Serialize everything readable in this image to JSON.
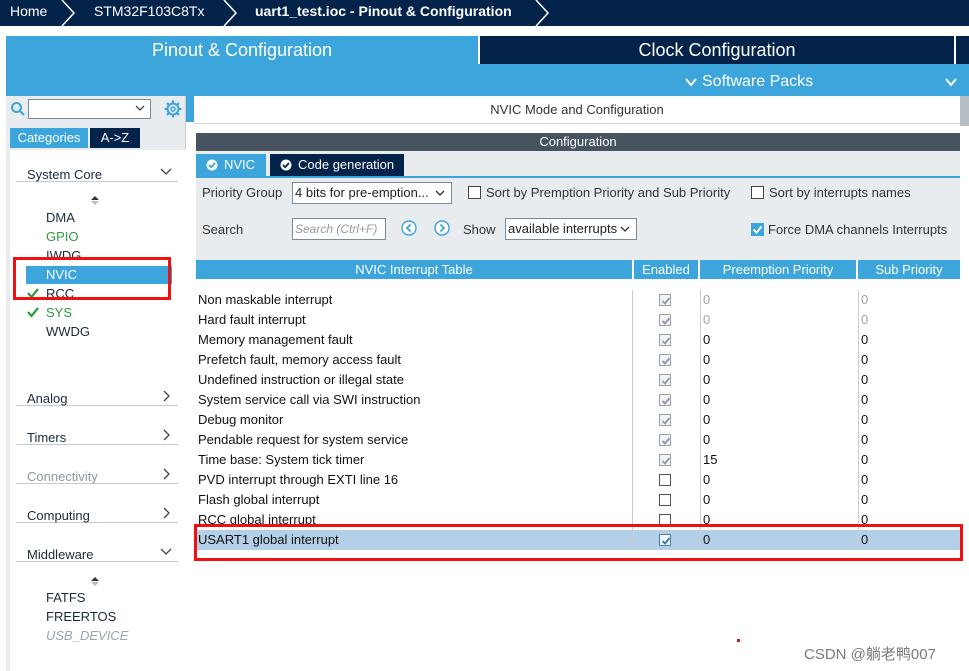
{
  "breadcrumb": [
    "Home",
    "STM32F103C8Tx",
    "uart1_test.ioc - Pinout & Configuration"
  ],
  "main_tabs": {
    "pinout": "Pinout & Configuration",
    "clock": "Clock Configuration",
    "software_packs": "Software Packs"
  },
  "left_panel": {
    "search_value": "",
    "tabs": [
      "Categories",
      "A->Z"
    ],
    "categories": [
      {
        "label": "System Core",
        "state": "expanded"
      },
      {
        "label": "Analog",
        "state": "collapsed"
      },
      {
        "label": "Timers",
        "state": "collapsed"
      },
      {
        "label": "Connectivity",
        "state": "collapsed"
      },
      {
        "label": "Computing",
        "state": "collapsed"
      },
      {
        "label": "Middleware",
        "state": "expanded"
      }
    ],
    "system_core_items": [
      {
        "label": "DMA",
        "style": "normal"
      },
      {
        "label": "GPIO",
        "style": "green"
      },
      {
        "label": "IWDG",
        "style": "normal"
      },
      {
        "label": "NVIC",
        "style": "selected"
      },
      {
        "label": "RCC",
        "style": "checked"
      },
      {
        "label": "SYS",
        "style": "checked"
      },
      {
        "label": "WWDG",
        "style": "normal"
      }
    ],
    "middleware_items": [
      {
        "label": "FATFS",
        "style": "normal"
      },
      {
        "label": "FREERTOS",
        "style": "normal"
      },
      {
        "label": "USB_DEVICE",
        "style": "disabled"
      }
    ]
  },
  "right_panel": {
    "title": "NVIC Mode and Configuration",
    "config_header": "Configuration",
    "subtabs": [
      "NVIC",
      "Code generation"
    ],
    "priority_group_label": "Priority Group",
    "priority_group_value": "4 bits for pre-emption...",
    "sort_preemption_label": "Sort by Premption Priority and Sub Priority",
    "sort_preemption_checked": false,
    "sort_names_label": "Sort by interrupts names",
    "sort_names_checked": false,
    "search_label": "Search",
    "search_placeholder": "Search (Ctrl+F)",
    "show_label": "Show",
    "show_value": "available interrupts",
    "force_dma_label": "Force DMA channels Interrupts",
    "force_dma_checked": true,
    "table": {
      "headers": [
        "NVIC Interrupt Table",
        "Enabled",
        "Preemption Priority",
        "Sub Priority"
      ],
      "rows": [
        {
          "name": "Non maskable interrupt",
          "enabled": true,
          "locked": true,
          "pre": "0",
          "sub": "0",
          "grey": true
        },
        {
          "name": "Hard fault interrupt",
          "enabled": true,
          "locked": true,
          "pre": "0",
          "sub": "0",
          "grey": true
        },
        {
          "name": "Memory management fault",
          "enabled": true,
          "locked": true,
          "pre": "0",
          "sub": "0",
          "grey": false
        },
        {
          "name": "Prefetch fault, memory access fault",
          "enabled": true,
          "locked": true,
          "pre": "0",
          "sub": "0",
          "grey": false
        },
        {
          "name": "Undefined instruction or illegal state",
          "enabled": true,
          "locked": true,
          "pre": "0",
          "sub": "0",
          "grey": false
        },
        {
          "name": "System service call via SWI instruction",
          "enabled": true,
          "locked": true,
          "pre": "0",
          "sub": "0",
          "grey": false
        },
        {
          "name": "Debug monitor",
          "enabled": true,
          "locked": true,
          "pre": "0",
          "sub": "0",
          "grey": false
        },
        {
          "name": "Pendable request for system service",
          "enabled": true,
          "locked": true,
          "pre": "0",
          "sub": "0",
          "grey": false
        },
        {
          "name": "Time base: System tick timer",
          "enabled": true,
          "locked": true,
          "pre": "15",
          "sub": "0",
          "grey": false
        },
        {
          "name": "PVD interrupt through EXTI line 16",
          "enabled": false,
          "locked": false,
          "pre": "0",
          "sub": "0",
          "grey": false
        },
        {
          "name": "Flash global interrupt",
          "enabled": false,
          "locked": false,
          "pre": "0",
          "sub": "0",
          "grey": false
        },
        {
          "name": "RCC global interrupt",
          "enabled": false,
          "locked": false,
          "pre": "0",
          "sub": "0",
          "grey": false
        },
        {
          "name": "USART1 global interrupt",
          "enabled": true,
          "locked": false,
          "pre": "0",
          "sub": "0",
          "grey": false,
          "selected": true
        }
      ]
    }
  },
  "watermark": "CSDN @躺老鸭007",
  "colors": {
    "navy": "#03234b",
    "blue": "#3ca5dc",
    "highlight_red": "#f01010",
    "row_selected": "#b4cfe8",
    "green": "#2e9b3d"
  }
}
